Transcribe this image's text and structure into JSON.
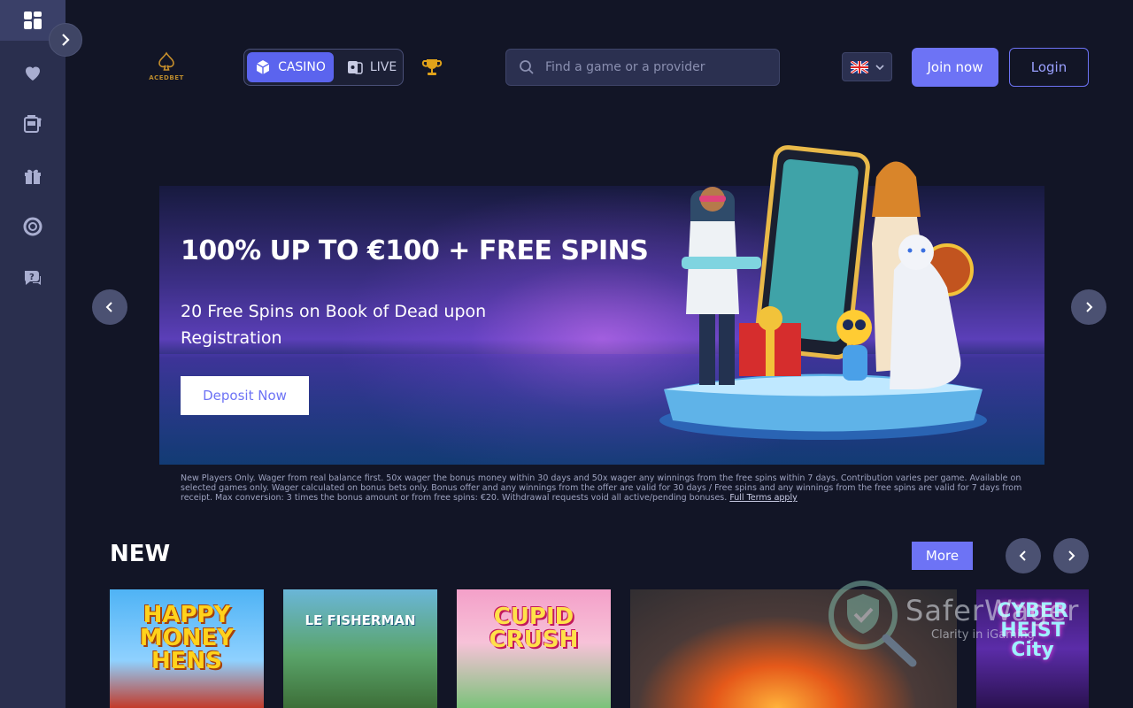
{
  "brand": {
    "logo_text": "ACEDBET"
  },
  "rail": {
    "items": [
      {
        "icon": "grid-icon"
      },
      {
        "icon": "heart-icon"
      },
      {
        "icon": "slot-machine-icon"
      },
      {
        "icon": "gift-icon"
      },
      {
        "icon": "lifebuoy-icon"
      },
      {
        "icon": "help-chat-icon"
      }
    ],
    "toggle_icon": "chevron-right-icon"
  },
  "header": {
    "tabs": [
      {
        "label": "CASINO",
        "icon": "cube-icon",
        "active": true
      },
      {
        "label": "LIVE",
        "icon": "cards-icon",
        "active": false
      }
    ],
    "search": {
      "placeholder": "Find a game or a provider",
      "value": ""
    },
    "language": {
      "flag": "uk-flag-icon"
    },
    "join_label": "Join now",
    "login_label": "Login"
  },
  "banner": {
    "title": "100% UP TO €100 + FREE SPINS",
    "subtitle": "20 Free Spins on Book of Dead upon Registration",
    "cta_label": "Deposit Now",
    "terms": "New Players Only. Wager from real balance first. 50x wager the bonus money within 30 days and 50x wager any winnings from the free spins within 7 days. Contribution varies per game. Available on selected games only. Wager calculated on bonus bets only. Bonus offer and any winnings from the offer are valid for 30 days / Free spins and any winnings from the free spins are valid for 7 days from receipt. Max conversion: 3 times the bonus amount or from free spins: €20. Withdrawal requests void all active/pending bonuses.",
    "terms_link": "Full Terms apply"
  },
  "new_section": {
    "title": "NEW",
    "more_label": "More",
    "games": [
      {
        "title": "HAPPY MONEY HENS"
      },
      {
        "title": "LE FISHERMAN"
      },
      {
        "title": "CUPID CRUSH"
      },
      {
        "title": ""
      },
      {
        "title": "CYBER HEIST City"
      }
    ]
  },
  "watermark": {
    "name": "SaferWager",
    "tagline": "Clarity in iGaming"
  },
  "colors": {
    "accent": "#6d73f5",
    "background": "#121526",
    "rail": "#2a2f4e"
  }
}
